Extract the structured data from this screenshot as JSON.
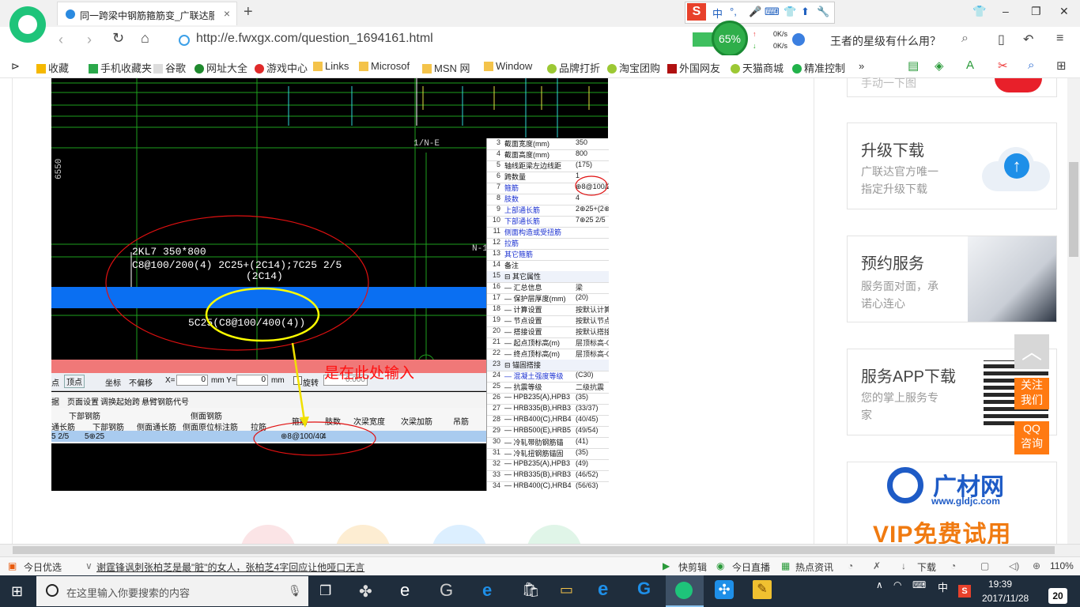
{
  "tab": {
    "title": "同一跨梁中钢筋箍筋变_广联达服",
    "close": "×",
    "new": "+"
  },
  "ime": {
    "logo": "S",
    "items": [
      "中",
      "°,",
      "🎤",
      "⌨",
      "👕",
      "⬆",
      "🔧"
    ]
  },
  "window": {
    "tshirt": "👕",
    "minimize": "–",
    "restore": "❐",
    "close": "✕"
  },
  "address": {
    "url": "http://e.fwxgx.com/question_1694161.html",
    "speed_pct": "65%",
    "up": "0K/s",
    "down": "0K/s",
    "search_text": "王者的星级有什么用？"
  },
  "bookmarks": [
    "收藏",
    "手机收藏夹",
    "谷歌",
    "网址大全",
    "游戏中心",
    "Links",
    "Microsof",
    "MSN 网",
    "Window",
    "品牌打折",
    "淘宝团购",
    "外国网友",
    "天猫商城",
    "精准控制"
  ],
  "cad": {
    "axis_label_left": "6550",
    "axis_label_top": "1/N-E",
    "axis_label_right": "N-1",
    "beam_line1": "2KL7 350*800",
    "beam_line2": "C8@100/200(4) 2C25+(2C14);7C25 2/5",
    "beam_line3": "(2C14)",
    "beam_line4": "5C25(C8@100/400(4))",
    "annotation": "是在此处输入",
    "toolbar1": [
      "点",
      "顶点",
      "坐标",
      "不偏移",
      "X=",
      "0",
      "mm Y=",
      "0",
      "mm",
      "旋转",
      "0.000"
    ],
    "toolbar2": [
      "据",
      "页面设置",
      "调换起始跨",
      "悬臂钢筋代号"
    ],
    "grid_groups": [
      "下部钢筋",
      "侧面钢筋"
    ],
    "grid_headers": [
      "通长筋",
      "下部钢筋",
      "侧面通长筋",
      "侧面原位标注筋",
      "拉筋",
      "箍筋",
      "肢数",
      "次梁宽度",
      "次梁加筋",
      "吊筋"
    ],
    "grid_row": [
      "5 2/5",
      "5⊕25",
      "",
      "",
      "",
      "⊕8@100/40",
      "4",
      "",
      "",
      ""
    ]
  },
  "props": [
    {
      "n": "3",
      "k": "截面宽度(mm)",
      "v": "350",
      "style": "kk"
    },
    {
      "n": "4",
      "k": "截面高度(mm)",
      "v": "800",
      "style": "kk"
    },
    {
      "n": "5",
      "k": "轴线距梁左边线距",
      "v": "(175)",
      "style": "kk"
    },
    {
      "n": "6",
      "k": "跨数量",
      "v": "1",
      "style": "kk"
    },
    {
      "n": "7",
      "k": "箍筋",
      "v": "⊕8@100/2",
      "style": "blue"
    },
    {
      "n": "8",
      "k": "肢数",
      "v": "4",
      "style": "blue"
    },
    {
      "n": "9",
      "k": "上部通长筋",
      "v": "2⊕25+(2⊕",
      "style": "blue"
    },
    {
      "n": "10",
      "k": "下部通长筋",
      "v": "7⊕25 2/5",
      "style": "blue"
    },
    {
      "n": "11",
      "k": "侧面构造或受扭筋",
      "v": "",
      "style": "blue"
    },
    {
      "n": "12",
      "k": "拉筋",
      "v": "",
      "style": "blue"
    },
    {
      "n": "13",
      "k": "其它箍筋",
      "v": "",
      "style": "blue"
    },
    {
      "n": "14",
      "k": "备注",
      "v": "",
      "style": "kk"
    },
    {
      "n": "15",
      "k": "⊟ 其它属性",
      "v": "",
      "style": "sec"
    },
    {
      "n": "16",
      "k": "— 汇总信息",
      "v": "梁",
      "style": "kk"
    },
    {
      "n": "17",
      "k": "— 保护层厚度(mm)",
      "v": "(20)",
      "style": "kk"
    },
    {
      "n": "18",
      "k": "— 计算设置",
      "v": "按默认计算",
      "style": "kk"
    },
    {
      "n": "19",
      "k": "— 节点设置",
      "v": "按默认节点",
      "style": "kk"
    },
    {
      "n": "20",
      "k": "— 搭接设置",
      "v": "按默认搭接",
      "style": "kk"
    },
    {
      "n": "21",
      "k": "— 起点顶标高(m)",
      "v": "层顶标高-0",
      "style": "kk"
    },
    {
      "n": "22",
      "k": "— 终点顶标高(m)",
      "v": "层顶标高-0",
      "style": "kk"
    },
    {
      "n": "23",
      "k": "⊟ 锚固搭接",
      "v": "",
      "style": "sec"
    },
    {
      "n": "24",
      "k": "— 混凝土强度等级",
      "v": "(C30)",
      "style": "blue"
    },
    {
      "n": "25",
      "k": "— 抗震等级",
      "v": "二级抗震",
      "style": "kk"
    },
    {
      "n": "26",
      "k": "— HPB235(A),HPB3",
      "v": "(35)",
      "style": "kk"
    },
    {
      "n": "27",
      "k": "— HRB335(B),HRB3",
      "v": "(33/37)",
      "style": "kk"
    },
    {
      "n": "28",
      "k": "— HRB400(C),HRB4",
      "v": "(40/45)",
      "style": "kk"
    },
    {
      "n": "29",
      "k": "— HRB500(E),HRB5",
      "v": "(49/54)",
      "style": "kk"
    },
    {
      "n": "30",
      "k": "— 冷轧带肋钢筋锚",
      "v": "(41)",
      "style": "kk"
    },
    {
      "n": "31",
      "k": "— 冷轧扭钢筋锚固",
      "v": "(35)",
      "style": "kk"
    },
    {
      "n": "32",
      "k": "— HPB235(A),HPB3",
      "v": "(49)",
      "style": "kk"
    },
    {
      "n": "33",
      "k": "— HRB335(B),HRB3",
      "v": "(46/52)",
      "style": "kk"
    },
    {
      "n": "34",
      "k": "— HRB400(C),HRB4",
      "v": "(56/63)",
      "style": "kk"
    }
  ],
  "sidebar": {
    "card0_text": "手动一下图",
    "cards": [
      {
        "title": "升级下载",
        "desc1": "广联达官方唯一",
        "desc2": "指定升级下载"
      },
      {
        "title": "预约服务",
        "desc1": "服务面对面，承",
        "desc2": "诺心连心"
      },
      {
        "title": "服务APP下载",
        "desc1": "您的掌上服务专",
        "desc2": "家"
      }
    ],
    "brand_name": "广材网",
    "brand_url": "www.gldjc.com",
    "brand_promo": "VIP免费试用"
  },
  "float": {
    "top": "︿",
    "follow1": "关注",
    "follow2": "我们",
    "qq1": "QQ",
    "qq2": "咨询"
  },
  "statusbar": {
    "left": "今日优选",
    "news": "谢霆锋讽刺张柏芝是最\"脏\"的女人，张柏芝4字回应让他哑口无言",
    "items": [
      "快剪辑",
      "今日直播",
      "热点资讯",
      "下载"
    ],
    "zoom": "110%"
  },
  "taskbar": {
    "search_placeholder": "在这里输入你要搜索的内容",
    "time": "19:39",
    "date": "2017/11/28",
    "ime": "中",
    "notif": "20"
  }
}
